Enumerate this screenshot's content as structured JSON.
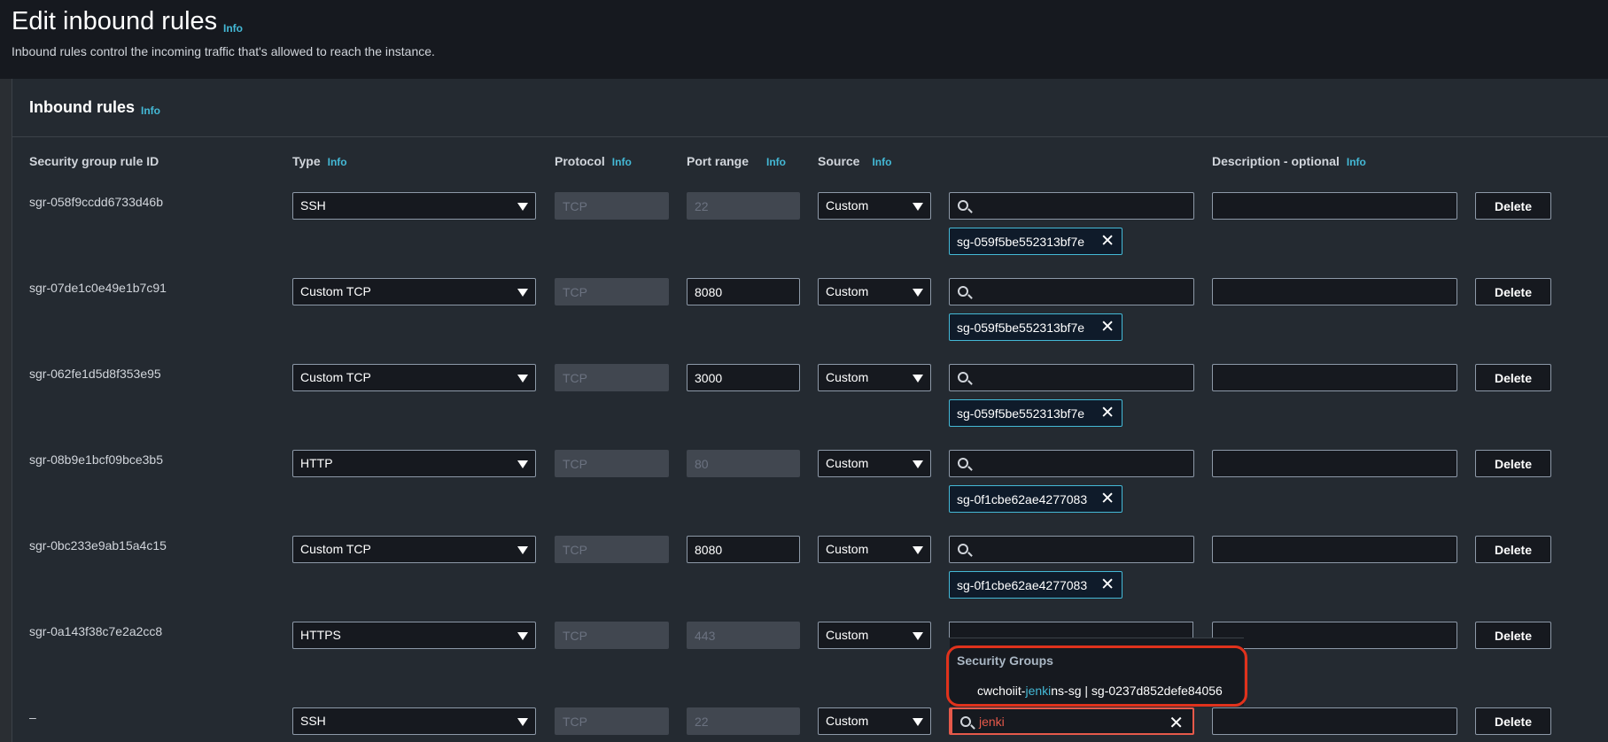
{
  "header": {
    "title": "Edit inbound rules",
    "title_info": "Info",
    "description": "Inbound rules control the incoming traffic that's allowed to reach the instance."
  },
  "panel": {
    "title": "Inbound rules",
    "title_info": "Info",
    "columns": {
      "rule_id": "Security group rule ID",
      "type": "Type",
      "type_info": "Info",
      "protocol": "Protocol",
      "protocol_info": "Info",
      "port_range": "Port range",
      "port_range_info": "Info",
      "source": "Source",
      "source_info": "Info",
      "description": "Description - optional",
      "description_info": "Info"
    }
  },
  "rules": [
    {
      "id": "sgr-058f9ccdd6733d46b",
      "type": "SSH",
      "protocol": "TCP",
      "port": "22",
      "port_editable": false,
      "source": "Custom",
      "token": "sg-059f5be552313bf7e",
      "delete": "Delete"
    },
    {
      "id": "sgr-07de1c0e49e1b7c91",
      "type": "Custom TCP",
      "protocol": "TCP",
      "port": "8080",
      "port_editable": true,
      "source": "Custom",
      "token": "sg-059f5be552313bf7e",
      "delete": "Delete"
    },
    {
      "id": "sgr-062fe1d5d8f353e95",
      "type": "Custom TCP",
      "protocol": "TCP",
      "port": "3000",
      "port_editable": true,
      "source": "Custom",
      "token": "sg-059f5be552313bf7e",
      "delete": "Delete"
    },
    {
      "id": "sgr-08b9e1bcf09bce3b5",
      "type": "HTTP",
      "protocol": "TCP",
      "port": "80",
      "port_editable": false,
      "source": "Custom",
      "token": "sg-0f1cbe62ae4277083",
      "delete": "Delete"
    },
    {
      "id": "sgr-0bc233e9ab15a4c15",
      "type": "Custom TCP",
      "protocol": "TCP",
      "port": "8080",
      "port_editable": true,
      "source": "Custom",
      "token": "sg-0f1cbe62ae4277083",
      "delete": "Delete"
    },
    {
      "id": "sgr-0a143f38c7e2a2cc8",
      "type": "HTTPS",
      "protocol": "TCP",
      "port": "443",
      "port_editable": false,
      "source": "Custom",
      "token": "",
      "delete": "Delete"
    },
    {
      "id": "–",
      "type": "SSH",
      "protocol": "TCP",
      "port": "22",
      "port_editable": false,
      "source": "Custom",
      "token": "",
      "search_value": "jenki",
      "delete": "Delete"
    }
  ],
  "dropdown": {
    "group_label": "Security Groups",
    "item_prefix": "cwchoiit-",
    "item_match": "jenki",
    "item_suffix": "ns-sg | sg-0237d852defe84056"
  },
  "colors": {
    "accent": "#44b9d6",
    "highlight": "#e0321c",
    "background": "#16191f"
  }
}
